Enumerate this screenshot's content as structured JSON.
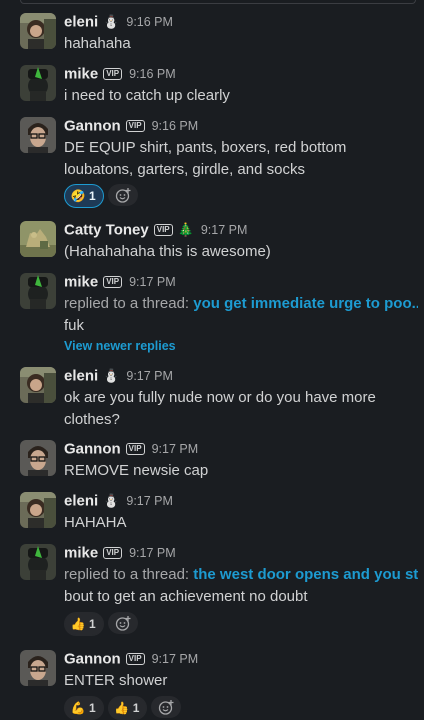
{
  "badge_label": "VIP",
  "status_icons": {
    "snowman": "⛄",
    "tree": "🎄"
  },
  "messages": [
    {
      "name": "eleni",
      "status": "⛄",
      "vip": false,
      "time": "9:16 PM",
      "text": "hahahaha",
      "avatar": "eleni-avatar"
    },
    {
      "name": "mike",
      "vip": true,
      "time": "9:16 PM",
      "text": "i need to catch up clearly",
      "avatar": "mike-avatar"
    },
    {
      "name": "Gannon",
      "vip": true,
      "time": "9:16 PM",
      "text": "DE EQUIP shirt, pants, boxers, red bottom loubatons, garters, girdle, and socks",
      "avatar": "gannon-avatar",
      "reactions": [
        {
          "emoji": "🤣",
          "count": "1",
          "active": true
        }
      ]
    },
    {
      "name": "Catty Toney",
      "vip": true,
      "status": "🎄",
      "time": "9:17 PM",
      "text": "(Hahahahaha this is awesome)",
      "avatar": "catty-avatar"
    },
    {
      "name": "mike",
      "vip": true,
      "time": "9:17 PM",
      "reply_label": "replied to a thread:",
      "reply_link": "you get immediate urge to poo...",
      "text": "fuk",
      "newer_replies": "View newer replies",
      "avatar": "mike-avatar"
    },
    {
      "name": "eleni",
      "status": "⛄",
      "vip": false,
      "time": "9:17 PM",
      "text": "ok are you fully nude now or do you have more clothes?",
      "avatar": "eleni-avatar"
    },
    {
      "name": "Gannon",
      "vip": true,
      "time": "9:17 PM",
      "text": "REMOVE newsie cap",
      "avatar": "gannon-avatar"
    },
    {
      "name": "eleni",
      "status": "⛄",
      "vip": false,
      "time": "9:17 PM",
      "text": "HAHAHA",
      "avatar": "eleni-avatar"
    },
    {
      "name": "mike",
      "vip": true,
      "time": "9:17 PM",
      "reply_label": "replied to a thread:",
      "reply_link": "the west door opens and you st...",
      "text": "bout to get an achievement no doubt",
      "avatar": "mike-avatar",
      "reactions": [
        {
          "emoji": "👍",
          "count": "1",
          "active": false
        }
      ]
    },
    {
      "name": "Gannon",
      "vip": true,
      "time": "9:17 PM",
      "text": "ENTER shower",
      "avatar": "gannon-avatar",
      "reactions": [
        {
          "emoji": "💪",
          "count": "1",
          "active": false
        },
        {
          "emoji": "👍",
          "count": "1",
          "active": false
        }
      ]
    }
  ],
  "colors": {
    "background": "#1a1d21",
    "link": "#1d9bd1",
    "text": "#d1d2d3",
    "muted": "#a6a7a9"
  }
}
